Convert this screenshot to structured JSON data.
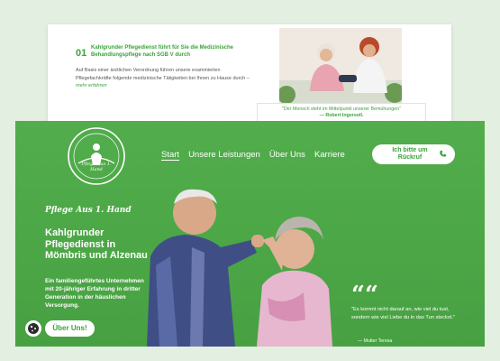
{
  "back_page": {
    "step_number": "01",
    "step_title": "Kahlgrunder Pflegedienst führt für Sie die  Medizinische Behandlungspflege nach SGB V durch",
    "step_text": "Auf Basis einer ärztlichen Verordnung führen unsere examinierten Pflegefachkräfte folgende medizinische Tätigkeiten bei Ihnen zu Hause durch –",
    "step_link": "mehr erfahren",
    "quote": "\"Der Mensch steht im Mittelpunkt unserer Bemühungen\"",
    "quote_author": "— Robert Ingersoll."
  },
  "header": {
    "logo_top_text": "KAHLGRUNDER PFLEGEDIENST",
    "logo_script": "Pflege Aus 1. Hand",
    "nav": [
      "Start",
      "Unsere Leistungen",
      "Über Uns",
      "Karriere"
    ],
    "callback_label": "Ich bitte um Rückruf"
  },
  "hero": {
    "script_title": "Pflege Aus 1. Hand",
    "title": "Kahlgrunder Pflegedienst in Mömbris und Alzenau",
    "description": "Ein familiengeführtes Unternehmen mit 20-jähriger Erfahrung in dritter Generation in der häuslichen Versorgung.",
    "cta_label": "Über Uns!",
    "quote_mark": "““",
    "quote": "\"Es kommt nicht darauf an, wie viel du tust, sondern wie viel Liebe du in das Tun steckst.\"",
    "quote_author": "— Mutter Teresa"
  },
  "icons": [
    "phone-icon",
    "cookie-icon",
    "quote-icon",
    "logo"
  ],
  "colors": {
    "brand_green": "#4ea94a",
    "accent_green": "#3aa33a",
    "background": "#e3f0e1"
  }
}
